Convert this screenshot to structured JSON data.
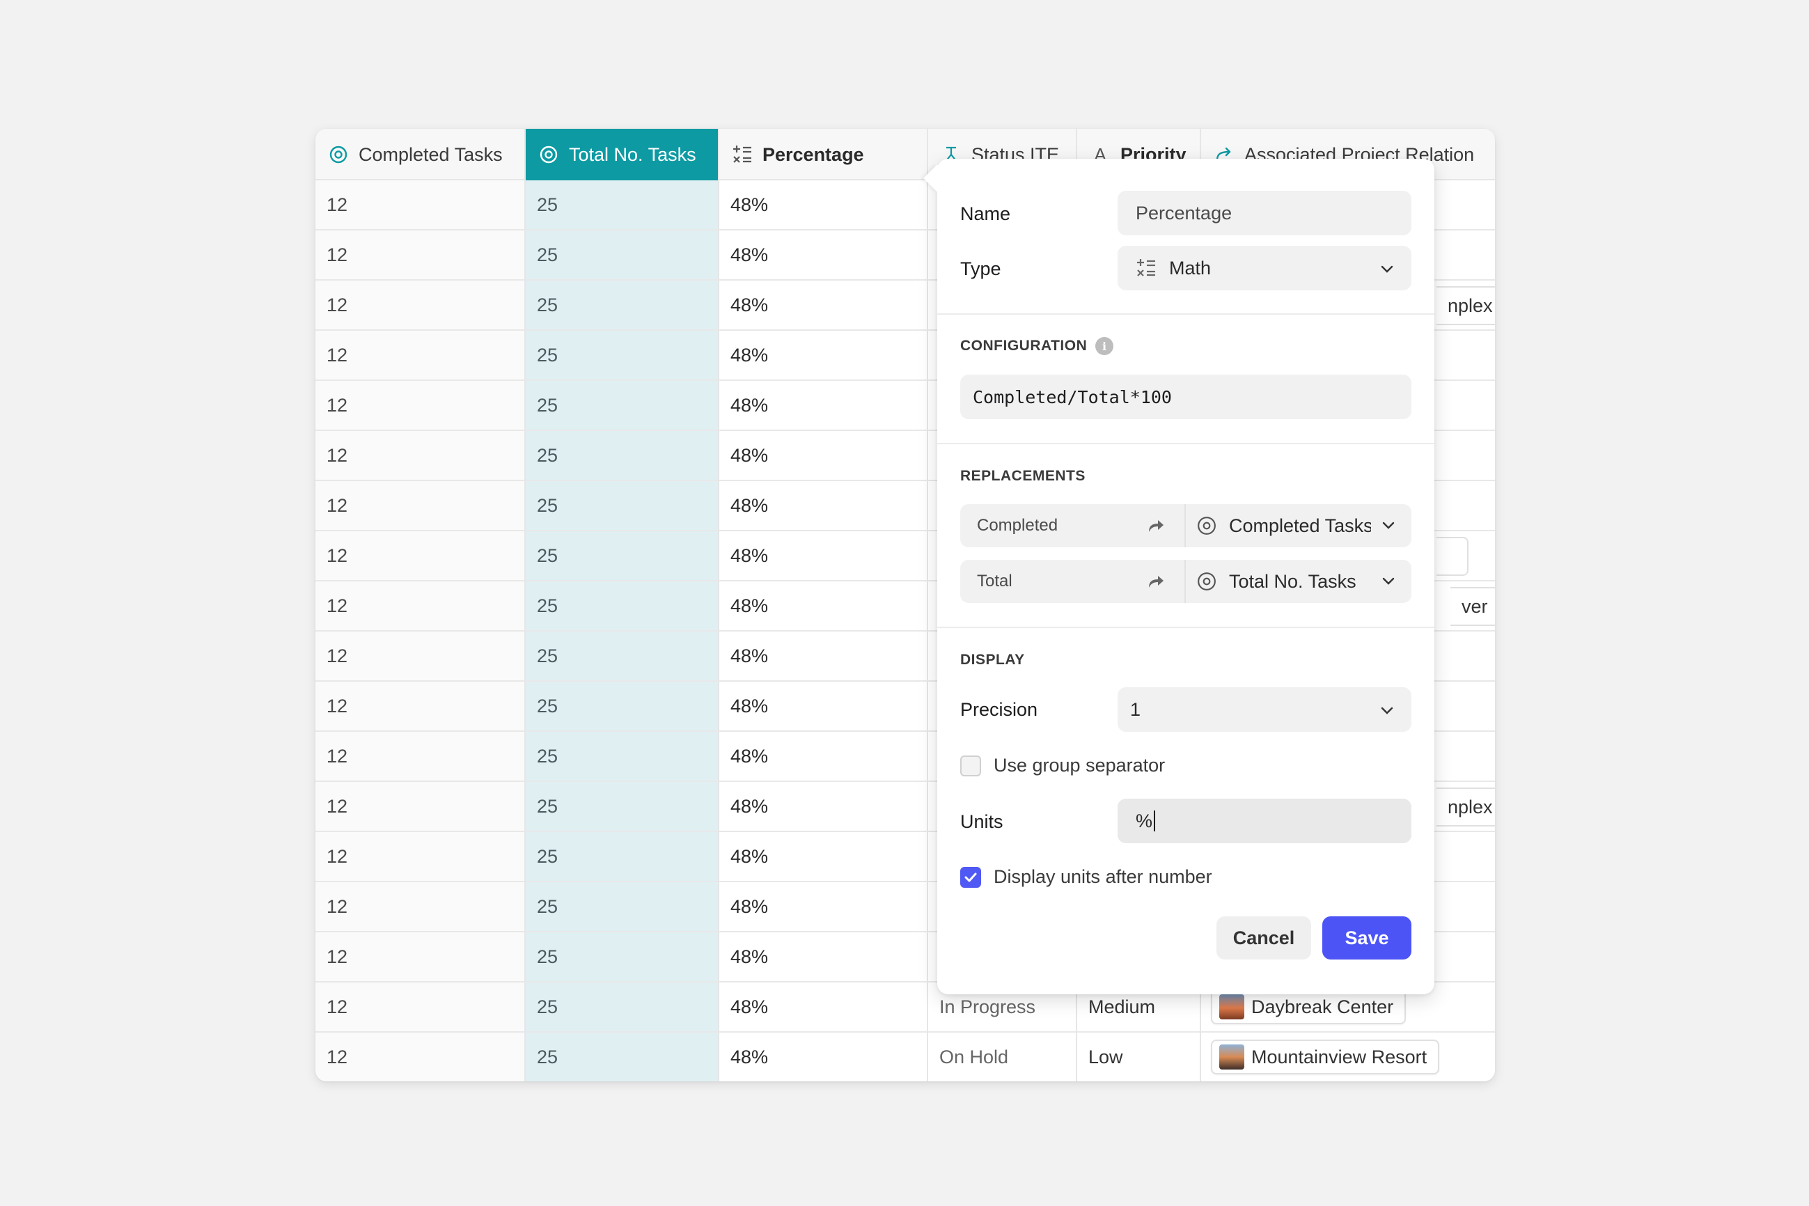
{
  "table": {
    "columns": [
      {
        "label": "Completed Tasks",
        "icon": "target-icon"
      },
      {
        "label": "Total No. Tasks",
        "icon": "target-icon"
      },
      {
        "label": "Percentage",
        "icon": "math-icon"
      },
      {
        "label": "Status ITE",
        "icon": "flask-icon"
      },
      {
        "label": "Priority",
        "icon": "text-type-icon"
      },
      {
        "label": "Associated Project Relation",
        "icon": "relation-arrow-icon"
      }
    ],
    "rows": [
      {
        "completed": "12",
        "total": "25",
        "percentage": "48%"
      },
      {
        "completed": "12",
        "total": "25",
        "percentage": "48%"
      },
      {
        "completed": "12",
        "total": "25",
        "percentage": "48%"
      },
      {
        "completed": "12",
        "total": "25",
        "percentage": "48%"
      },
      {
        "completed": "12",
        "total": "25",
        "percentage": "48%"
      },
      {
        "completed": "12",
        "total": "25",
        "percentage": "48%"
      },
      {
        "completed": "12",
        "total": "25",
        "percentage": "48%"
      },
      {
        "completed": "12",
        "total": "25",
        "percentage": "48%"
      },
      {
        "completed": "12",
        "total": "25",
        "percentage": "48%"
      },
      {
        "completed": "12",
        "total": "25",
        "percentage": "48%"
      },
      {
        "completed": "12",
        "total": "25",
        "percentage": "48%"
      },
      {
        "completed": "12",
        "total": "25",
        "percentage": "48%"
      },
      {
        "completed": "12",
        "total": "25",
        "percentage": "48%"
      },
      {
        "completed": "12",
        "total": "25",
        "percentage": "48%"
      },
      {
        "completed": "12",
        "total": "25",
        "percentage": "48%"
      },
      {
        "completed": "12",
        "total": "25",
        "percentage": "48%"
      },
      {
        "completed": "12",
        "total": "25",
        "percentage": "48%",
        "status": "In Progress",
        "priority": "Medium",
        "project": "Daybreak Center"
      },
      {
        "completed": "12",
        "total": "25",
        "percentage": "48%",
        "status": "On Hold",
        "priority": "Low",
        "project": "Mountainview Resort"
      }
    ],
    "peeks": {
      "row3": "nplex",
      "row9": "ver",
      "row13": "nplex"
    }
  },
  "popover": {
    "name_label": "Name",
    "name_value": "Percentage",
    "type_label": "Type",
    "type_value": "Math",
    "configuration_title": "CONFIGURATION",
    "info_glyph": "i",
    "formula": "Completed/Total*100",
    "replacements_title": "REPLACEMENTS",
    "replacements": [
      {
        "key": "Completed",
        "value": "Completed Tasks"
      },
      {
        "key": "Total",
        "value": "Total No. Tasks"
      }
    ],
    "display_title": "DISPLAY",
    "precision_label": "Precision",
    "precision_value": "1",
    "group_separator_label": "Use group separator",
    "group_separator_checked": false,
    "units_label": "Units",
    "units_value": "%",
    "units_after_label": "Display units after number",
    "units_after_checked": true,
    "cancel_label": "Cancel",
    "save_label": "Save"
  },
  "colors": {
    "accent_teal": "#0d9aa3",
    "selected_column_bg": "#e0eff2",
    "save_button": "#4c54f6",
    "checkbox_checked": "#5159f5"
  }
}
